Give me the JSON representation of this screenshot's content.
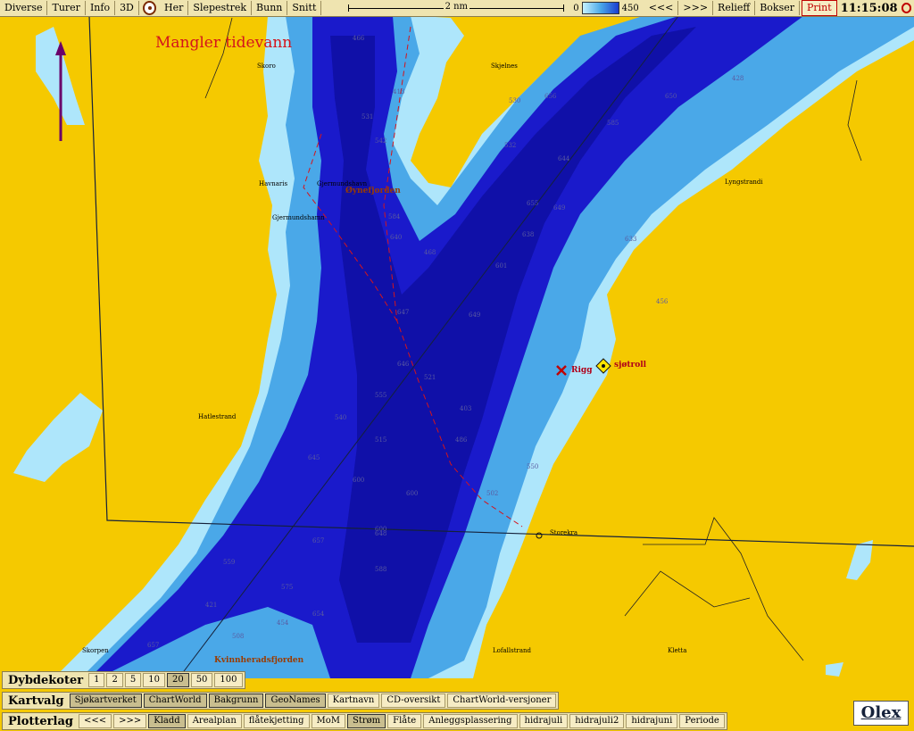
{
  "toolbar": {
    "buttons": [
      "Diverse",
      "Turer",
      "Info",
      "3D"
    ],
    "buttons2": [
      "Her",
      "Slepestrek",
      "Bunn",
      "Snitt"
    ],
    "scale_label": "2 nm",
    "depth_min": "0",
    "depth_max": "450",
    "nav_prev": "<<<",
    "nav_next": ">>>",
    "relief": "Relieff",
    "boxes": "Bokser",
    "print": "Print",
    "time": "11:15:08"
  },
  "map": {
    "warning": "Mangler tidevann",
    "fjords": {
      "oyne": "Øynefjorden",
      "kvinnherad": "Kvinnheradsfjorden"
    },
    "places": {
      "skoro": "Skoro",
      "skjelnes": "Skjelnes",
      "havnaris": "Havnaris",
      "gjermundshavn": "Gjermundshavn",
      "gjermundshamn": "Gjermundshamn",
      "lyngstrandi": "Lyngstrandi",
      "hatlestrand": "Hatlestrand",
      "storekra": "Storekra",
      "lofallstrand": "Lofallstrand",
      "kletta": "Kletta",
      "skorpen": "Skorpen"
    },
    "markers": {
      "rigg": "Rigg",
      "sjotroll": "sjøtroll"
    },
    "depths": [
      "466",
      "413",
      "531",
      "542",
      "584",
      "530",
      "644",
      "649",
      "601",
      "638",
      "649",
      "655",
      "646",
      "521",
      "555",
      "540",
      "515",
      "600",
      "645",
      "600",
      "648",
      "657",
      "559",
      "588",
      "575",
      "508",
      "454",
      "654",
      "657",
      "421",
      "403",
      "486",
      "532",
      "656",
      "456",
      "468",
      "640",
      "600",
      "647",
      "585",
      "650",
      "633",
      "428",
      "502",
      "550"
    ]
  },
  "depth_contours": {
    "title": "Dybdekoter",
    "options": [
      "1",
      "2",
      "5",
      "10",
      "20",
      "50",
      "100"
    ],
    "selected": "20"
  },
  "chart_select": {
    "title": "Kartvalg",
    "items": [
      "Sjøkartverket",
      "ChartWorld",
      "Bakgrunn",
      "GeoNames",
      "Kartnavn",
      "CD-oversikt",
      "ChartWorld-versjoner"
    ],
    "active": [
      "Sjøkartverket",
      "ChartWorld",
      "Bakgrunn",
      "GeoNames"
    ]
  },
  "plotter_layers": {
    "title": "Plotterlag",
    "nav_prev": "<<<",
    "nav_next": ">>>",
    "items": [
      "Kladd",
      "Arealplan",
      "flåtekjetting",
      "MoM",
      "Strøm",
      "Flåte",
      "Anleggsplassering",
      "hidrajuli",
      "hidrajuli2",
      "hidrajuni",
      "Periode"
    ],
    "active": [
      "Kladd",
      "Strøm"
    ]
  },
  "brand": "Olex",
  "colors": {
    "land": "#f5c900",
    "deep": "#1a1acb",
    "shallow": "#c6f2ff",
    "warning": "#d4141c"
  }
}
